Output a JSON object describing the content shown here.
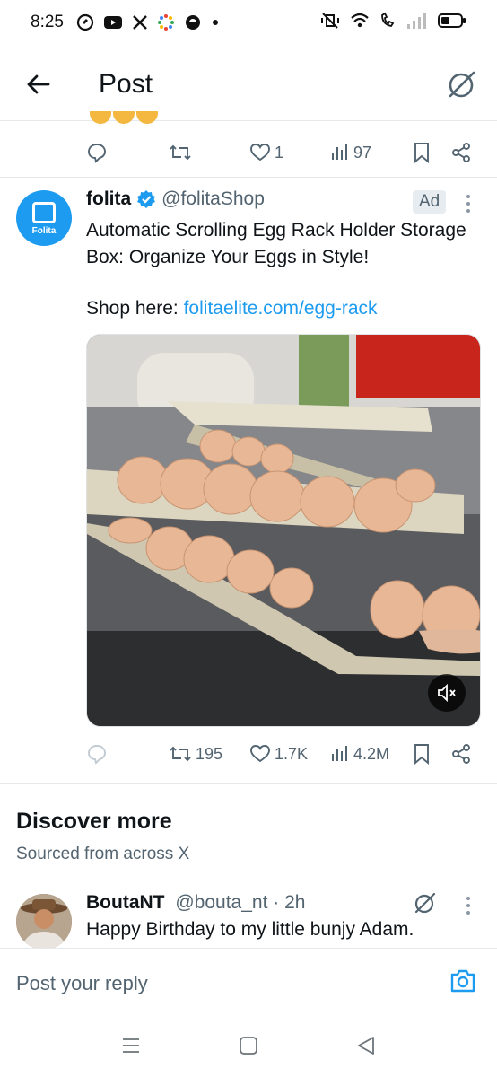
{
  "status_bar": {
    "time": "8:25",
    "left_icons": [
      "threads-icon",
      "youtube-icon",
      "x-icon",
      "loading-ring-icon",
      "edge-icon",
      "dot-icon"
    ],
    "right_icons": [
      "mute-vibrate-icon",
      "wifi-icon",
      "volte-icon",
      "signal-icon",
      "battery-icon"
    ]
  },
  "header": {
    "title": "Post",
    "back_icon": "arrow-left-icon",
    "grok_icon": "grok-icon"
  },
  "previous_post_actions": {
    "reply_count": "",
    "retweet_count": "",
    "like_count": "1",
    "view_count": "97"
  },
  "ad_post": {
    "avatar_text": "Folita",
    "name": "folita",
    "handle": "@folitaShop",
    "ad_label": "Ad",
    "text": "Automatic Scrolling Egg Rack Holder Storage Box: Organize Your Eggs in Style!",
    "link_prefix": "Shop here: ",
    "link_text": "folitaelite.com/egg-rack",
    "media_description_icon": "mute-icon",
    "actions": {
      "reply_count": "",
      "retweet_count": "195",
      "like_count": "1.7K",
      "view_count": "4.2M"
    }
  },
  "discover": {
    "title": "Discover more",
    "subtitle": "Sourced from across X"
  },
  "next_post": {
    "name": "BoutaNT",
    "handle": "@bouta_nt",
    "separator": " · ",
    "time": "2h",
    "text": "Happy Birthday to my little bunjy Adam."
  },
  "reply_bar": {
    "placeholder": "Post your reply",
    "camera_icon": "camera-icon"
  },
  "nav_bar": {
    "icons": [
      "menu-icon",
      "home-square-icon",
      "back-triangle-icon"
    ]
  },
  "colors": {
    "accent": "#1d9bf0",
    "text_primary": "#0f1419",
    "text_secondary": "#536471",
    "divider": "#e6e9ec"
  }
}
